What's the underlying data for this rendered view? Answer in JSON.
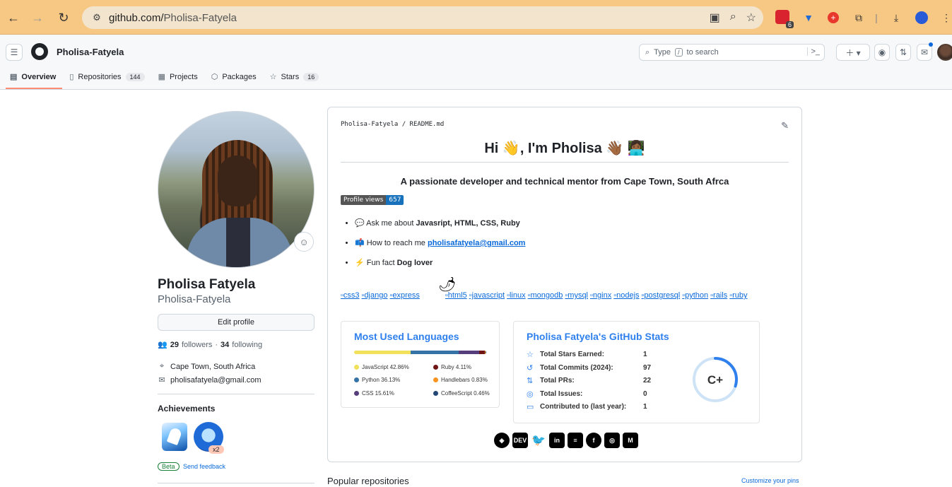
{
  "browser": {
    "url_host": "github.com/",
    "url_path": "Pholisa-Fatyela",
    "ext_badge_count": "6"
  },
  "header": {
    "username": "Pholisa-Fatyela",
    "search_prefix": "Type",
    "search_key": "/",
    "search_suffix": "to search"
  },
  "tabs": [
    {
      "label": "Overview",
      "icon": "book-icon"
    },
    {
      "label": "Repositories",
      "count": "144",
      "icon": "repo-icon"
    },
    {
      "label": "Projects",
      "icon": "table-icon"
    },
    {
      "label": "Packages",
      "icon": "package-icon"
    },
    {
      "label": "Stars",
      "count": "16",
      "icon": "star-icon"
    }
  ],
  "profile": {
    "name": "Pholisa Fatyela",
    "login": "Pholisa-Fatyela",
    "edit_label": "Edit profile",
    "followers": "29",
    "followers_label": "followers",
    "following": "34",
    "following_label": "following",
    "location": "Cape Town, South Africa",
    "email": "pholisafatyela@gmail.com",
    "achievements_title": "Achievements",
    "achievement_multiplier": "x2",
    "beta_label": "Beta",
    "feedback_label": "Send feedback"
  },
  "readme": {
    "path_owner": "Pholisa-Fatyela",
    "path_sep": "/",
    "path_file": "README.md",
    "heading": "Hi 👋, I'm Pholisa 👋🏾 👩🏾‍💻",
    "tagline": "A passionate developer and technical mentor from Cape Town, South Afrca",
    "views_label": "Profile views",
    "views_count": "657",
    "bullets": [
      {
        "emoji": "💬",
        "prefix": "Ask me about ",
        "bold": "Javasript, HTML, CSS, Ruby"
      },
      {
        "emoji": "📫",
        "prefix": "How to reach me ",
        "link": "pholisafatyela@gmail.com"
      },
      {
        "emoji": "⚡",
        "prefix": "Fun fact ",
        "bold": "Dog lover"
      }
    ],
    "tech": [
      "css3",
      "django",
      "express",
      "html5",
      "javascript",
      "linux",
      "mongodb",
      "mysql",
      "nginx",
      "nodejs",
      "postgresql",
      "python",
      "rails",
      "ruby"
    ]
  },
  "languages_card": {
    "title": "Most Used Languages",
    "items": [
      {
        "name": "JavaScript",
        "pct": "42.86%",
        "value": 42.86,
        "color": "#f1e05a"
      },
      {
        "name": "Python",
        "pct": "36.13%",
        "value": 36.13,
        "color": "#3572a5"
      },
      {
        "name": "CSS",
        "pct": "15.61%",
        "value": 15.61,
        "color": "#563d7c"
      },
      {
        "name": "Ruby",
        "pct": "4.11%",
        "value": 4.11,
        "color": "#701516"
      },
      {
        "name": "Handlebars",
        "pct": "0.83%",
        "value": 0.83,
        "color": "#f7931e"
      },
      {
        "name": "CoffeeScript",
        "pct": "0.46%",
        "value": 0.46,
        "color": "#244776"
      }
    ]
  },
  "stats_card": {
    "title": "Pholisa Fatyela's GitHub Stats",
    "rows": [
      {
        "label": "Total Stars Earned:",
        "value": "1",
        "icon": "star-icon"
      },
      {
        "label": "Total Commits (2024):",
        "value": "97",
        "icon": "history-icon"
      },
      {
        "label": "Total PRs:",
        "value": "22",
        "icon": "pull-request-icon"
      },
      {
        "label": "Total Issues:",
        "value": "0",
        "icon": "issue-icon"
      },
      {
        "label": "Contributed to (last year):",
        "value": "1",
        "icon": "repo-icon"
      }
    ],
    "rank": "C+",
    "rank_progress": 0.3
  },
  "socials": [
    "codepen",
    "DEV",
    "twitter",
    "linkedin",
    "stackoverflow",
    "facebook",
    "instagram",
    "M"
  ],
  "popular_title": "Popular repositories",
  "customize_label": "Customize your pins"
}
